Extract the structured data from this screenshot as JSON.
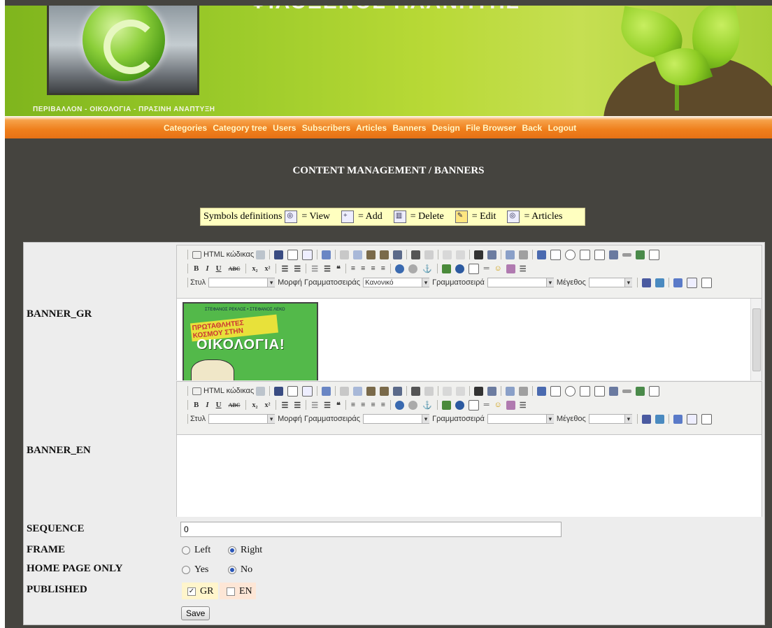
{
  "header": {
    "site_title": "ΦΙΛΟΞΕΝΟΣ ΠΛΑΝΗΤΗΣ",
    "tagline": "ΠΕΡΙΒΑΛΛΟΝ - ΟΙΚΟΛΟΓΙΑ - ΠΡΑΣΙΝΗ ΑΝΑΠΤΥΞΗ"
  },
  "nav": {
    "items": [
      "Categories",
      "Category tree",
      "Users",
      "Subscribers",
      "Articles",
      "Banners",
      "Design",
      "File Browser",
      "Back",
      "Logout"
    ]
  },
  "page": {
    "title": "CONTENT MANAGEMENT / BANNERS"
  },
  "symbols": {
    "intro": "Symbols definitions",
    "view": "= View",
    "add": "= Add",
    "delete": "= Delete",
    "edit": "= Edit",
    "articles": "= Articles"
  },
  "editor_toolbar": {
    "html_source": "HTML κώδικας",
    "style_label": "Στυλ",
    "format_label": "Μορφή Γραμματοσειράς",
    "font_label": "Γραμματοσειρά",
    "size_label": "Μέγεθος"
  },
  "form": {
    "banner_gr": {
      "label": "BANNER_GR",
      "format_value": "Κανονικό",
      "image": {
        "top": "ΣΤΕΦΑΝΟΣ ΡΕΚΛΟΣ • ΣΤΕΦΑΝΟΣ ΛΕΚΟ",
        "title": "ΠΡΩΤΑΘΛΗΤΕΣ ΚΟΣΜΟΥ ΣΤΗΝ",
        "main": "ΟΙΚΟΛΟΓΙΑ!"
      }
    },
    "banner_en": {
      "label": "BANNER_EN",
      "format_value": ""
    },
    "sequence": {
      "label": "SEQUENCE",
      "value": "0"
    },
    "frame": {
      "label": "FRAME",
      "options": [
        "Left",
        "Right"
      ],
      "selected": "Right"
    },
    "home_page_only": {
      "label": "HOME PAGE ONLY",
      "options": [
        "Yes",
        "No"
      ],
      "selected": "No"
    },
    "published": {
      "label": "PUBLISHED",
      "gr": "GR",
      "en": "EN",
      "gr_checked": true,
      "en_checked": false
    },
    "save_label": "Save"
  }
}
